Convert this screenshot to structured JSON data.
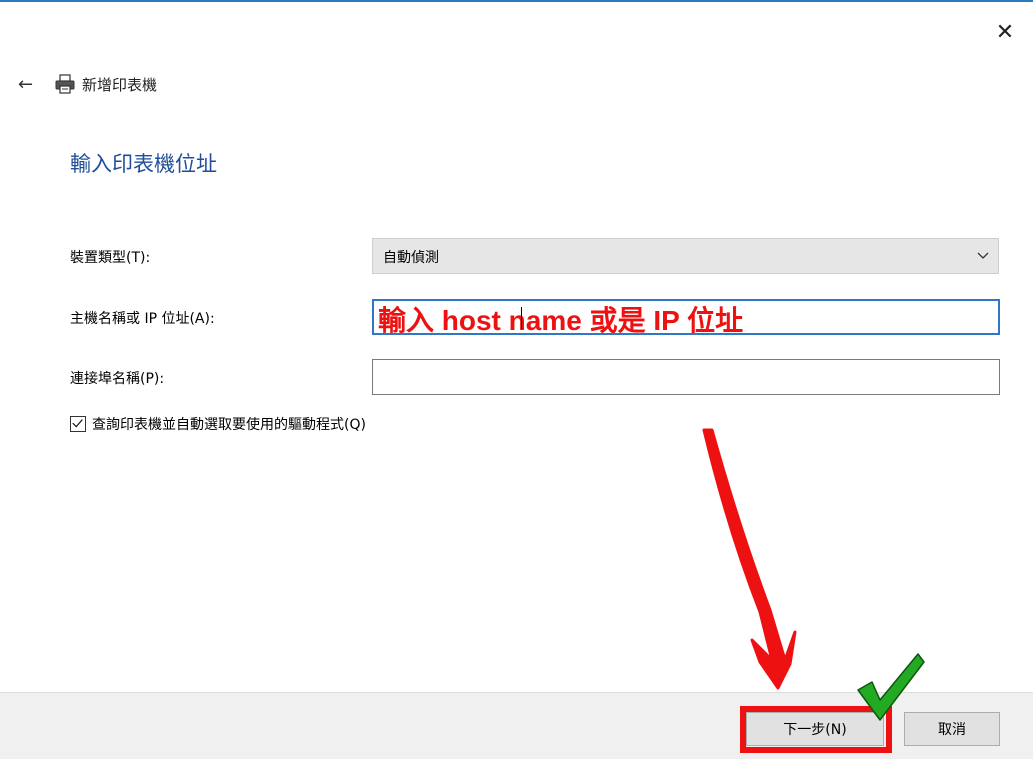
{
  "window": {
    "close_glyph": "✕"
  },
  "nav": {
    "back_glyph": "←",
    "title": "新增印表機"
  },
  "page": {
    "heading": "輸入印表機位址"
  },
  "form": {
    "device_type": {
      "label": "裝置類型(T):",
      "value": "自動偵測"
    },
    "hostname": {
      "label": "主機名稱或 IP 位址(A):",
      "value": "",
      "annotation": "輸入 host name 或是 IP 位址"
    },
    "port_name": {
      "label": "連接埠名稱(P):",
      "value": ""
    },
    "query_printer": {
      "label": "查詢印表機並自動選取要使用的驅動程式(Q)",
      "checked": true
    }
  },
  "footer": {
    "next_label": "下一步(N)",
    "cancel_label": "取消"
  },
  "colors": {
    "accent": "#2e78c7",
    "heading": "#1f4e99",
    "annotation_red": "#ee1111",
    "check_green": "#22aa22"
  }
}
